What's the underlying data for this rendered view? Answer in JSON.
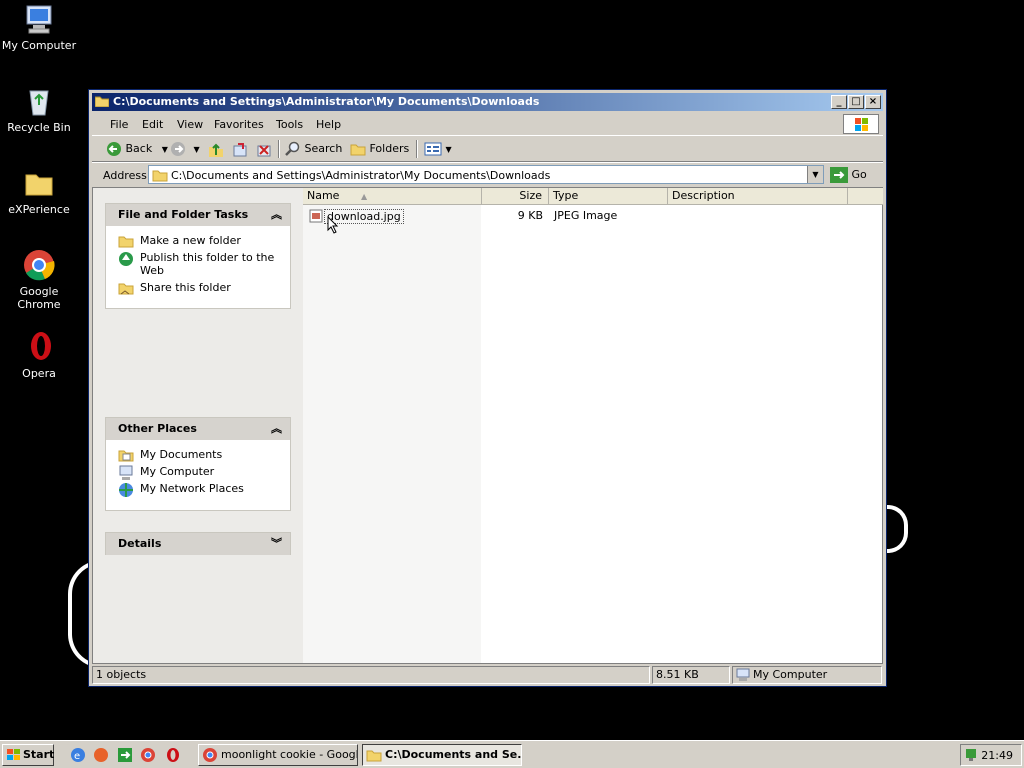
{
  "desktop": {
    "icons": [
      {
        "label": "My Computer",
        "icon": "my-computer-icon"
      },
      {
        "label": "Recycle Bin",
        "icon": "recycle-bin-icon"
      },
      {
        "label": "eXPerience",
        "icon": "folder-icon"
      },
      {
        "label": "Google Chrome",
        "icon": "chrome-icon"
      },
      {
        "label": "Opera",
        "icon": "opera-icon"
      }
    ]
  },
  "window": {
    "title": "C:\\Documents and Settings\\Administrator\\My Documents\\Downloads",
    "menu": [
      "File",
      "Edit",
      "View",
      "Favorites",
      "Tools",
      "Help"
    ],
    "toolbar": {
      "back": "Back",
      "search": "Search",
      "folders": "Folders"
    },
    "address": {
      "label": "Address",
      "value": "C:\\Documents and Settings\\Administrator\\My Documents\\Downloads",
      "go": "Go"
    },
    "taskpane": {
      "file_tasks": {
        "title": "File and Folder Tasks",
        "links": [
          "Make a new folder",
          "Publish this folder to the Web",
          "Share this folder"
        ]
      },
      "other_places": {
        "title": "Other Places",
        "links": [
          "My Documents",
          "My Computer",
          "My Network Places"
        ]
      },
      "details": {
        "title": "Details"
      }
    },
    "columns": [
      "Name",
      "Size",
      "Type",
      "Description"
    ],
    "files": [
      {
        "name": "download.jpg",
        "size": "9 KB",
        "type": "JPEG Image",
        "description": ""
      }
    ],
    "status": {
      "objects": "1 objects",
      "size": "8.51 KB",
      "location": "My Computer"
    }
  },
  "taskbar": {
    "start": "Start",
    "tasks": [
      {
        "label": "moonlight cookie - Googl...",
        "active": false
      },
      {
        "label": "C:\\Documents and Se...",
        "active": true
      }
    ],
    "clock": "21:49"
  },
  "colors": {
    "titlebar_start": "#0a246a",
    "titlebar_end": "#a6caf0",
    "face": "#d4d0c8"
  }
}
